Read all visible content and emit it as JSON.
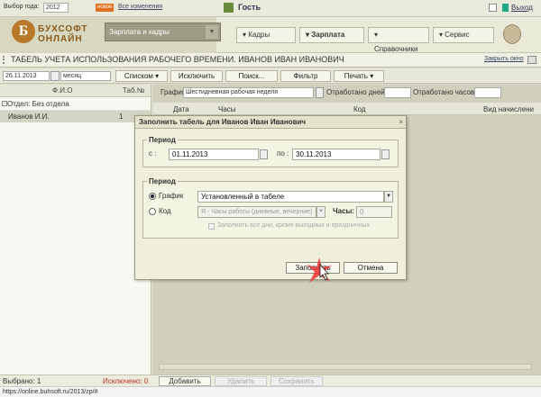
{
  "top": {
    "year_label": "Выбор года:",
    "year": "2012",
    "badge": "новое",
    "news": "Все изменения",
    "home_icon": "home-icon",
    "user": "Гость",
    "exit": "Выход"
  },
  "brand": {
    "line1": "БУХСОФТ",
    "line2": "ОНЛАЙН",
    "logo_letter": "Б"
  },
  "module": "Зарплата и кадры",
  "menu": [
    "Кадры",
    "Зарплата",
    "Справочники",
    "Сервис"
  ],
  "page": {
    "title": "ТАБЕЛЬ УЧЕТА ИСПОЛЬЗОВАНИЯ РАБОЧЕГО ВРЕМЕНИ. ИВАНОВ ИВАН ИВАНОВИЧ",
    "close": "Закрыть окно"
  },
  "toolbar": {
    "date": "26.11.2013",
    "period": "месяц",
    "list": "Списком",
    "exclude": "Исключить",
    "search": "Поиск...",
    "filter": "Фильтр",
    "print": "Печать"
  },
  "left": {
    "col_fio": "Ф.И.О",
    "col_tab": "Таб.№",
    "group": "Отдел: Без отдела",
    "rows": [
      {
        "name": "Иванов И.И.",
        "tab": "1"
      }
    ],
    "selected": "Выбрано: 1",
    "excluded": "Исключено: 0"
  },
  "right": {
    "schedule_label": "График:",
    "schedule": "Шестидневная рабочая неделя",
    "worked_days": "Отработано дней:",
    "worked_hours": "Отработано часов:",
    "cols": [
      "Дата",
      "Часы",
      "Код",
      "Вид начислени"
    ],
    "add": "Добавить",
    "delete": "Удалить",
    "save": "Сохранить"
  },
  "dialog": {
    "title": "Заполнить табель для Иванов Иван Иванович",
    "period1": "Период",
    "from": "с :",
    "from_val": "01.11.2013",
    "to": "по :",
    "to_val": "30.11.2013",
    "period2": "Период",
    "opt_schedule": "График",
    "schedule_val": "Установленный в табеле",
    "opt_code": "Код",
    "code_val": "Я - Часы работы (дневные, вечерние)",
    "hours": "Часы:",
    "hours_val": "0",
    "check": "Заполнять все дни, кроме выходных и праздничных",
    "fill": "Заполнить",
    "cancel": "Отмена"
  },
  "url": "https://online.buhsoft.ru/2013/zp/#"
}
